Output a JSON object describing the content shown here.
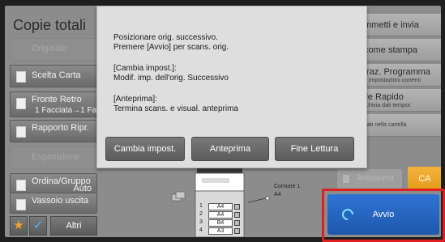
{
  "header": {
    "title": "Copie totali"
  },
  "left_buttons": {
    "originale": "Originale",
    "scelta_carta": "Scelta Carta",
    "fronte_retro": {
      "label": "Fronte Retro",
      "value": "1 Facciata→1 Fa"
    },
    "rapporto": "Rapporto Ripr.",
    "esposizione": "Esposizione",
    "ordina": {
      "label": "Ordina/Gruppo",
      "value": "Auto"
    },
    "vassoio": "Vassoio uscita",
    "altri": "Altri"
  },
  "right_buttons": {
    "trasmetti": "mmetti e invia",
    "stampa": "come stampa",
    "programma": {
      "label": "traz. Programma",
      "sub": "a impostazioni correnti"
    },
    "rapido": {
      "label": "ile Rapido",
      "sub": "rchivia dati tempor."
    },
    "cartella": {
      "sub": "dati nella cartella"
    }
  },
  "dialog": {
    "line1": "Posizionare orig. successivo.",
    "line2": "Premere [Avvio] per scans. orig.",
    "line3": "[Cambia impost.]:",
    "line4": "Modif. imp. dell'orig. Successivo",
    "line5": "[Anteprima]:",
    "line6": "Termina scans. e visual. anteprima",
    "btn_cambia": "Cambia impost.",
    "btn_anteprima": "Anteprima",
    "btn_fine": "Fine Lettura"
  },
  "machine": {
    "paper_label": "Comune 1",
    "paper_size": "A4",
    "trays": [
      {
        "num": "1",
        "size": "A4"
      },
      {
        "num": "2",
        "size": "A4"
      },
      {
        "num": "3",
        "size": "B4"
      },
      {
        "num": "4",
        "size": "A3"
      }
    ]
  },
  "actions": {
    "anteprima": "Anteprima",
    "ca": "CA",
    "avvio": "Avvio"
  },
  "colors": {
    "accent_orange": "#e59a17",
    "start_blue": "#1e57ac",
    "highlight_red": "#e02020"
  },
  "icons": [
    "star-icon",
    "check-icon",
    "start-icon"
  ]
}
